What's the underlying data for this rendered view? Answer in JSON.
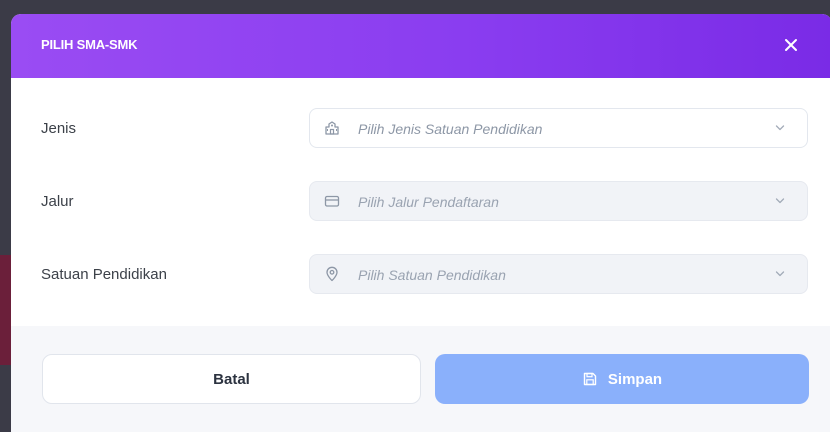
{
  "modal": {
    "title": "PILIH SMA-SMK",
    "close_icon": "close-icon"
  },
  "fields": [
    {
      "label": "Jenis",
      "placeholder": "Pilih Jenis Satuan Pendidikan",
      "icon": "school-building-icon",
      "disabled": false
    },
    {
      "label": "Jalur",
      "placeholder": "Pilih Jalur Pendaftaran",
      "icon": "card-icon",
      "disabled": true
    },
    {
      "label": "Satuan Pendidikan",
      "placeholder": "Pilih Satuan Pendidikan",
      "icon": "location-pin-icon",
      "disabled": true
    }
  ],
  "footer": {
    "cancel_label": "Batal",
    "save_label": "Simpan",
    "save_icon": "floppy-disk-icon"
  },
  "colors": {
    "header_gradient_start": "#9a4cf3",
    "header_gradient_end": "#7a2be6",
    "save_button": "#8ab0fb",
    "disabled_field": "#f1f3f7"
  }
}
